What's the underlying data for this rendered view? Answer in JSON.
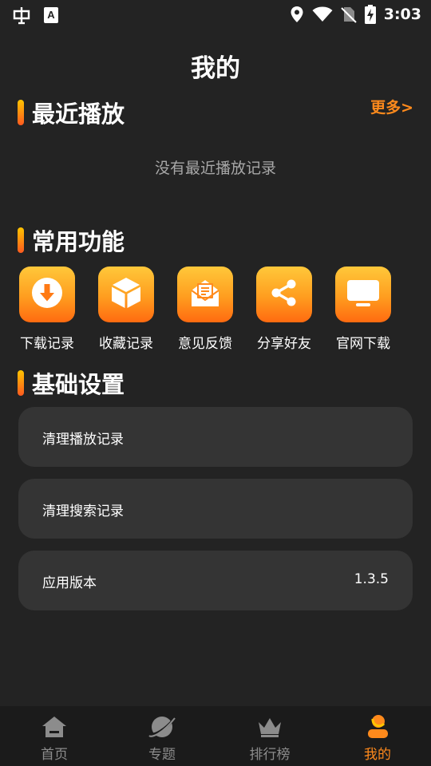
{
  "status_bar": {
    "time": "3:03",
    "notif_icon_text": "A"
  },
  "page_title": "我的",
  "recent": {
    "title": "最近播放",
    "more": "更多>",
    "empty": "没有最近播放记录"
  },
  "functions": {
    "title": "常用功能",
    "items": [
      {
        "label": "下载记录",
        "icon": "download-icon"
      },
      {
        "label": "收藏记录",
        "icon": "box-icon"
      },
      {
        "label": "意见反馈",
        "icon": "feedback-mail-icon"
      },
      {
        "label": "分享好友",
        "icon": "share-icon"
      },
      {
        "label": "官网下载",
        "icon": "monitor-icon"
      }
    ]
  },
  "settings": {
    "title": "基础设置",
    "items": [
      {
        "label": "清理播放记录",
        "value": ""
      },
      {
        "label": "清理搜索记录",
        "value": ""
      },
      {
        "label": "应用版本",
        "value": "1.3.5"
      }
    ]
  },
  "tabbar": {
    "items": [
      {
        "label": "首页",
        "icon": "home-icon",
        "active": false
      },
      {
        "label": "专题",
        "icon": "planet-icon",
        "active": false
      },
      {
        "label": "排行榜",
        "icon": "crown-icon",
        "active": false
      },
      {
        "label": "我的",
        "icon": "user-icon",
        "active": true
      }
    ]
  },
  "colors": {
    "background": "#232323",
    "card": "#343434",
    "accent": "#ff8a1c",
    "tabbar": "#1b1b1b"
  }
}
